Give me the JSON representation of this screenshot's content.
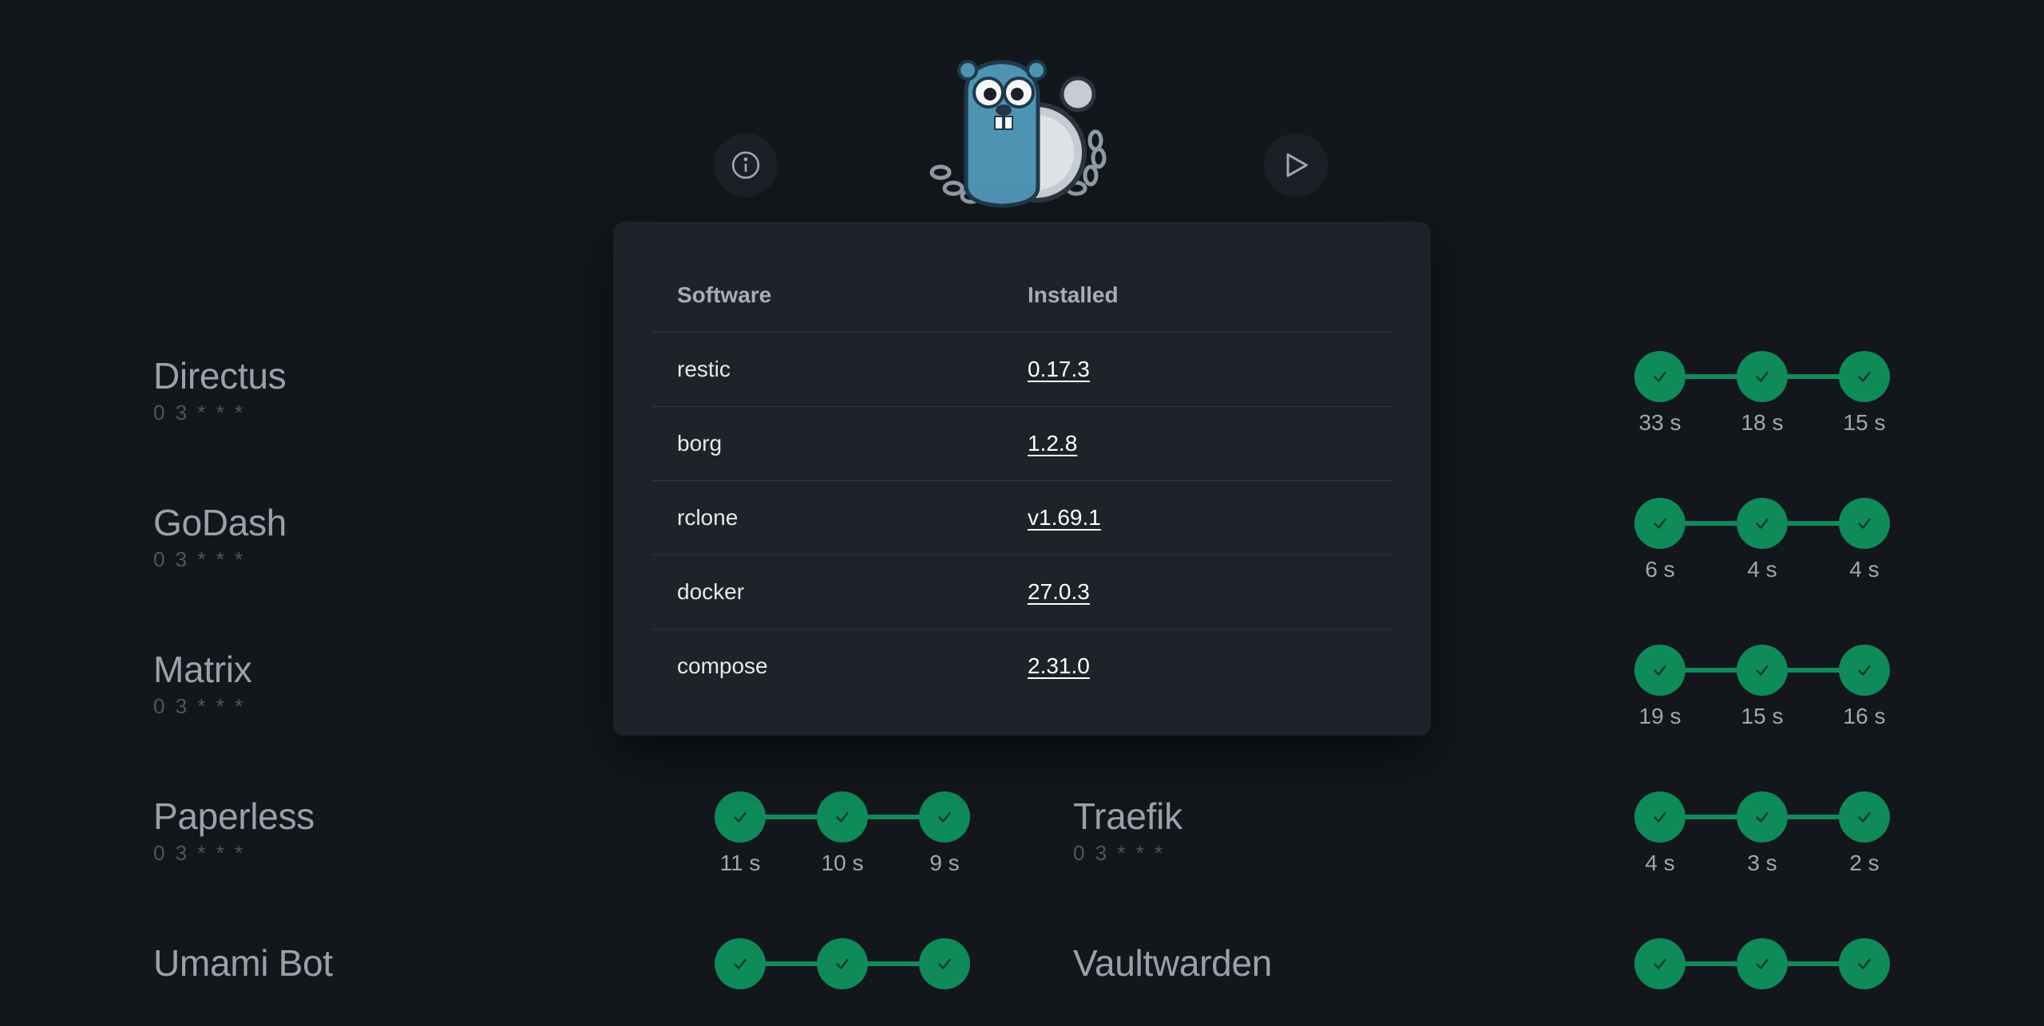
{
  "header": {
    "info_label": "info",
    "run_label": "run"
  },
  "left_column": [
    {
      "name": "Directus",
      "schedule": "0 3 * * *"
    },
    {
      "name": "GoDash",
      "schedule": "0 3 * * *"
    },
    {
      "name": "Matrix",
      "schedule": "0 3 * * *"
    },
    {
      "name": "Paperless",
      "schedule": "0 3 * * *",
      "durations": [
        "11 s",
        "10 s",
        "9 s"
      ]
    },
    {
      "name": "Umami Bot",
      "schedule": ""
    }
  ],
  "right_column": [
    {
      "durations": [
        "33 s",
        "18 s",
        "15 s"
      ]
    },
    {
      "durations": [
        "6 s",
        "4 s",
        "4 s"
      ]
    },
    {
      "durations": [
        "19 s",
        "15 s",
        "16 s"
      ]
    },
    {
      "name": "Traefik",
      "schedule": "0 3 * * *",
      "durations": [
        "4 s",
        "3 s",
        "2 s"
      ]
    },
    {
      "name": "Vaultwarden"
    }
  ],
  "modal": {
    "headers": {
      "software": "Software",
      "installed": "Installed"
    },
    "rows": [
      {
        "software": "restic",
        "version": "0.17.3"
      },
      {
        "software": "borg",
        "version": "1.2.8"
      },
      {
        "software": "rclone",
        "version": "v1.69.1"
      },
      {
        "software": "docker",
        "version": "27.0.3"
      },
      {
        "software": "compose",
        "version": "2.31.0"
      }
    ]
  },
  "colors": {
    "background": "#13171c",
    "success": "#0f8a59",
    "modal": "#1e232a"
  }
}
